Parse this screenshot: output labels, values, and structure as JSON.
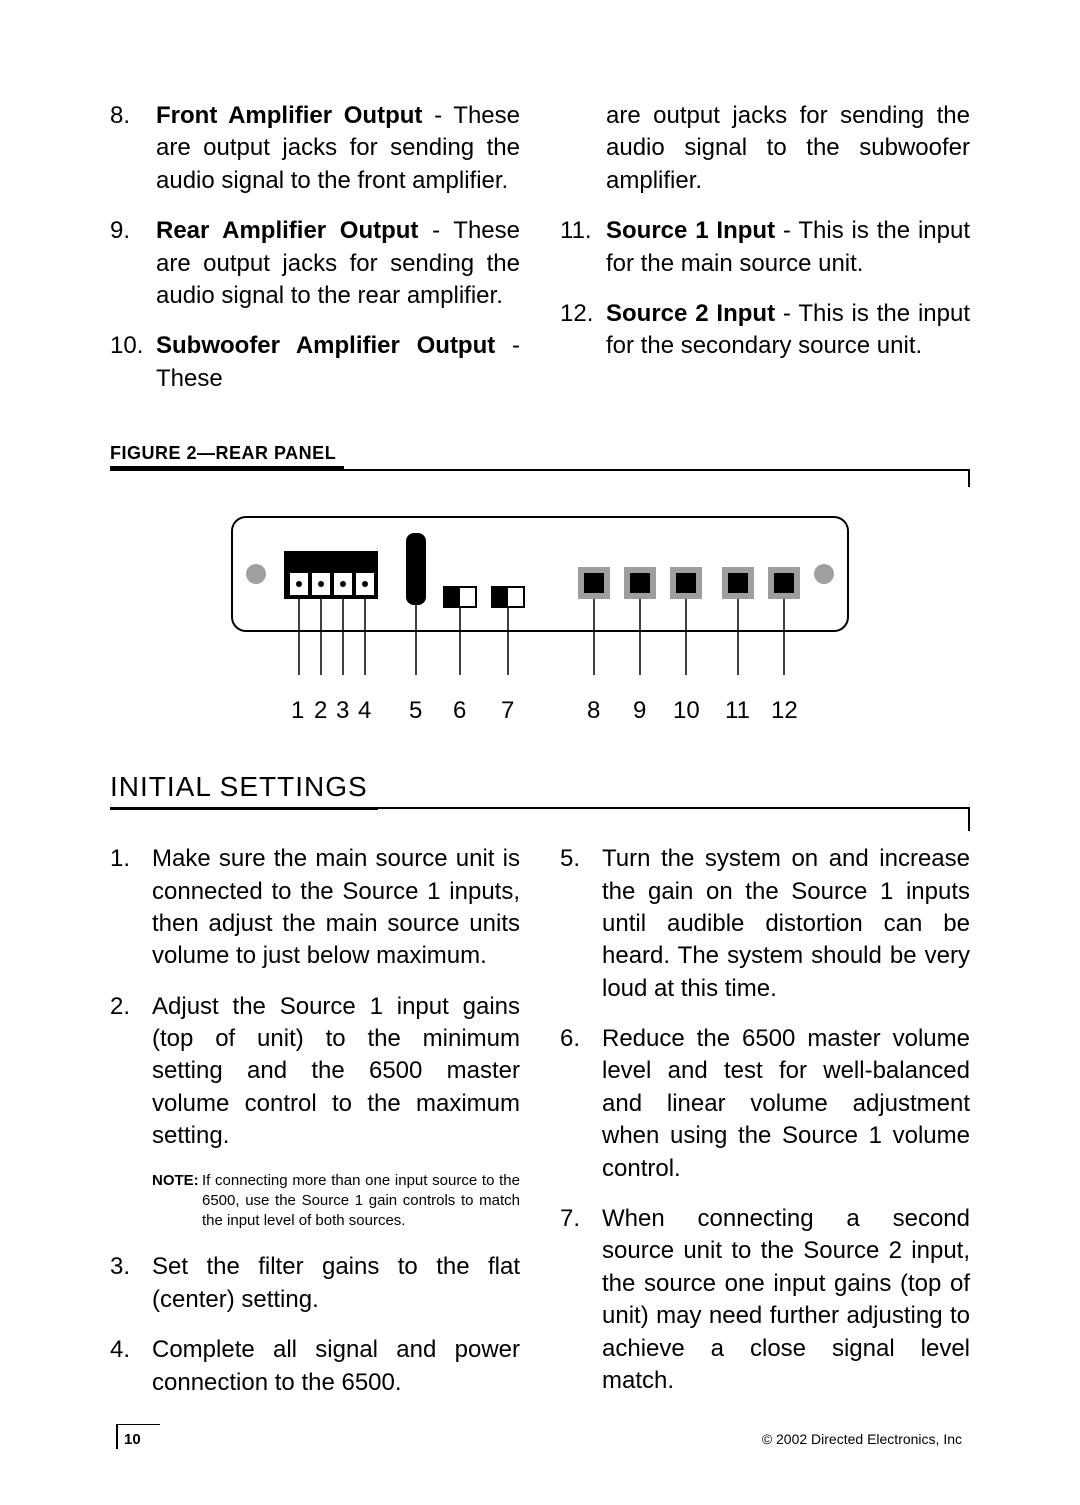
{
  "top_items": [
    {
      "n": "8.",
      "bold": "Front Amplifier Output",
      "rest": " - These are output jacks for sending the audio signal to the front amplifier."
    },
    {
      "n": "9.",
      "bold": "Rear Amplifier Output",
      "rest": " - These are output jacks for sending the audio signal to the rear amplifier."
    },
    {
      "n": "10.",
      "bold": "Subwoofer Amplifier Output",
      "rest": " - These"
    }
  ],
  "top_continued": "are output jacks for sending the audio signal to the subwoofer amplifier.",
  "top_items_right": [
    {
      "n": "11.",
      "bold": "Source 1 Input",
      "rest": " - This is the input for the main source unit."
    },
    {
      "n": "12.",
      "bold": "Source 2 Input",
      "rest": " - This is the input for the secondary source unit."
    }
  ],
  "figure_label": "FIGURE 2—REAR PANEL",
  "diagram_numbers": [
    "1",
    "2",
    "3",
    "4",
    "5",
    "6",
    "7",
    "8",
    "9",
    "10",
    "11",
    "12"
  ],
  "section_heading": "INITIAL SETTINGS",
  "steps_left": [
    {
      "n": "1.",
      "t": "Make sure the main source unit is connected to the Source 1 inputs, then adjust the main source units volume to just below maximum."
    },
    {
      "n": "2.",
      "t": "Adjust the Source 1 input gains (top of unit) to the minimum setting and the 6500 master volume control to the maximum setting."
    }
  ],
  "note_label": "NOTE:",
  "note_text": "If connecting more than one input source to the 6500, use the Source 1 gain controls to match the input level of both sources.",
  "steps_left2": [
    {
      "n": "3.",
      "t": "Set the filter gains to the flat (center) setting."
    },
    {
      "n": "4.",
      "t": "Complete all signal and power connection to the 6500."
    }
  ],
  "steps_right": [
    {
      "n": "5.",
      "t": "Turn the system on and increase the gain on the Source 1 inputs until audible distortion can be heard. The system should be very loud at this time."
    },
    {
      "n": "6.",
      "t": "Reduce the 6500 master volume level and test for well-balanced and linear volume adjustment when using the Source 1 volume control."
    },
    {
      "n": "7.",
      "t": "When connecting a second source unit to the Source 2 input, the source one input gains (top of unit) may need further adjusting to achieve a close signal level match."
    }
  ],
  "page_number": "10",
  "copyright": "© 2002 Directed Electronics, Inc"
}
